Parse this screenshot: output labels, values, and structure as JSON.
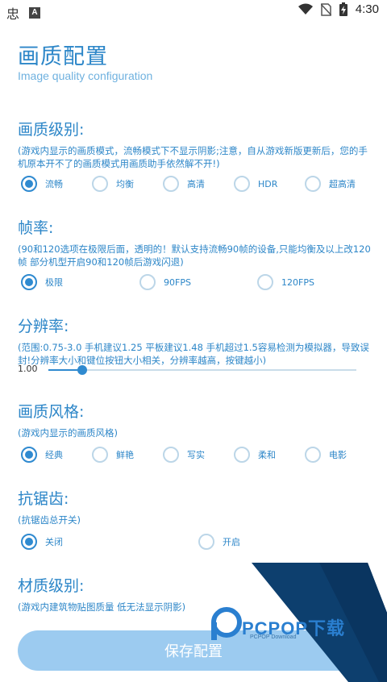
{
  "status_bar": {
    "time": "4:30",
    "icons": [
      "app-icon",
      "a-notification-icon",
      "wifi-icon",
      "no-sim-icon",
      "battery-charging-icon"
    ],
    "app_icon_glyph": "忠",
    "a_glyph": "A"
  },
  "header": {
    "title": "画质配置",
    "subtitle": "Image quality configuration"
  },
  "sections": {
    "quality": {
      "title": "画质级别:",
      "desc": "(游戏内显示的画质模式，流畅模式下不显示阴影;注意，自从游戏新版更新后，您的手机原本开不了的画质模式用画质助手依然解不开!)",
      "options": [
        "流畅",
        "均衡",
        "高清",
        "HDR",
        "超高清"
      ],
      "selected": "流畅"
    },
    "framerate": {
      "title": "帧率:",
      "desc": "(90和120选项在极限后面，透明的！默认支持流畅90帧的设备,只能均衡及以上改120帧  部分机型开启90和120帧后游戏闪退)",
      "options": [
        "极限",
        "90FPS",
        "120FPS"
      ],
      "selected": "极限"
    },
    "resolution": {
      "title": "分辨率:",
      "desc": "(范围:0.75-3.0  手机建议1.25 平板建议1.48  手机超过1.5容易检测为模拟器，导致误封!分辨率大小和键位按钮大小相关，分辨率越高，按键越小)",
      "value": "1.00",
      "min": 0.75,
      "max": 3.0
    },
    "style": {
      "title": "画质风格:",
      "desc": "(游戏内显示的画质风格)",
      "options": [
        "经典",
        "鲜艳",
        "写实",
        "柔和",
        "电影"
      ],
      "selected": "经典"
    },
    "antialias": {
      "title": "抗锯齿:",
      "desc": "(抗锯齿总开关)",
      "options": [
        "关闭",
        "开启"
      ],
      "selected": "关闭"
    },
    "material": {
      "title": "材质级别:",
      "desc": "(游戏内建筑物贴图质量 低无法显示阴影)"
    }
  },
  "save_button": "保存配置",
  "watermark": {
    "text": "PCPOP下载",
    "sub": "PCPOP Download",
    "colors": {
      "dark_blue": "#0d3f6e",
      "accent_blue": "#2a7fd0"
    }
  },
  "colors": {
    "accent": "#2c86c8",
    "radio_on": "#2f8ad0",
    "button": "#9ccbf0"
  }
}
